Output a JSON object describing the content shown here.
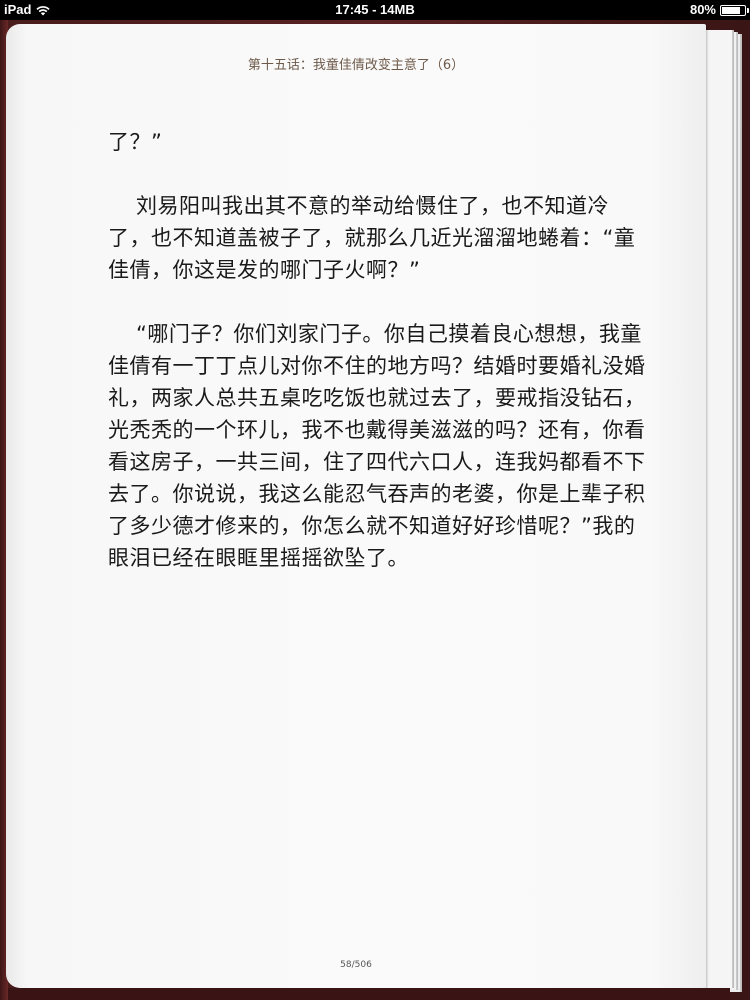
{
  "status_bar": {
    "device": "iPad",
    "time": "17:45 - 14MB",
    "battery_percent": "80%",
    "battery_level": 0.8
  },
  "book": {
    "chapter_title": "第十五话：我童佳倩改变主意了（6）",
    "paragraphs": [
      "了？”",
      "刘易阳叫我出其不意的举动给慑住了，也不知道冷了，也不知道盖被子了，就那么几近光溜溜地蜷着：“童佳倩，你这是发的哪门子火啊？”",
      "“哪门子？你们刘家门子。你自己摸着良心想想，我童佳倩有一丁丁点儿对你不住的地方吗？结婚时要婚礼没婚礼，两家人总共五桌吃吃饭也就过去了，要戒指没钻石，光秃秃的一个环儿，我不也戴得美滋滋的吗？还有，你看看这房子，一共三间，住了四代六口人，连我妈都看不下去了。你说说，我这么能忍气吞声的老婆，你是上辈子积了多少德才修来的，你怎么就不知道好好珍惜呢？”我的眼泪已经在眼眶里摇摇欲坠了。"
    ],
    "page_number": "58/506"
  }
}
